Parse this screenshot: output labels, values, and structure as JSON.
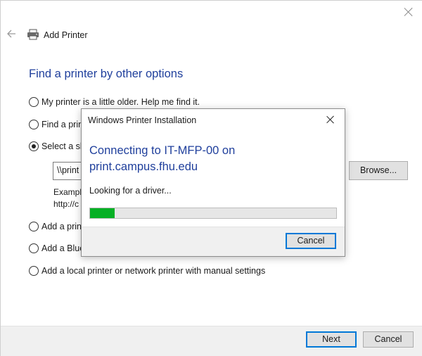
{
  "wizard": {
    "title": "Add Printer",
    "heading": "Find a printer by other options",
    "options": [
      {
        "label": "My printer is a little older. Help me find it.",
        "checked": false
      },
      {
        "label": "Find a prin",
        "checked": false
      },
      {
        "label": "Select a sh",
        "checked": true
      },
      {
        "label": "Add a prin",
        "checked": false
      },
      {
        "label": "Add a Blue",
        "checked": false
      },
      {
        "label": "Add a local printer or network printer with manual settings",
        "checked": false
      }
    ],
    "share_input_value": "\\\\print",
    "example_line1": "Exampl",
    "example_line2": "http://c",
    "browse_label": "Browse...",
    "next_label": "Next",
    "cancel_label": "Cancel",
    "back_icon": "back-arrow-icon",
    "printer_icon": "printer-icon"
  },
  "dialog": {
    "title": "Windows Printer Installation",
    "heading": "Connecting to IT-MFP-00 on print.campus.fhu.edu",
    "status": "Looking for a driver...",
    "progress_percent": 10,
    "progress_color": "#06b025",
    "cancel_label": "Cancel"
  },
  "colors": {
    "heading_blue": "#1f3f9c",
    "focus_blue": "#0078d7"
  }
}
